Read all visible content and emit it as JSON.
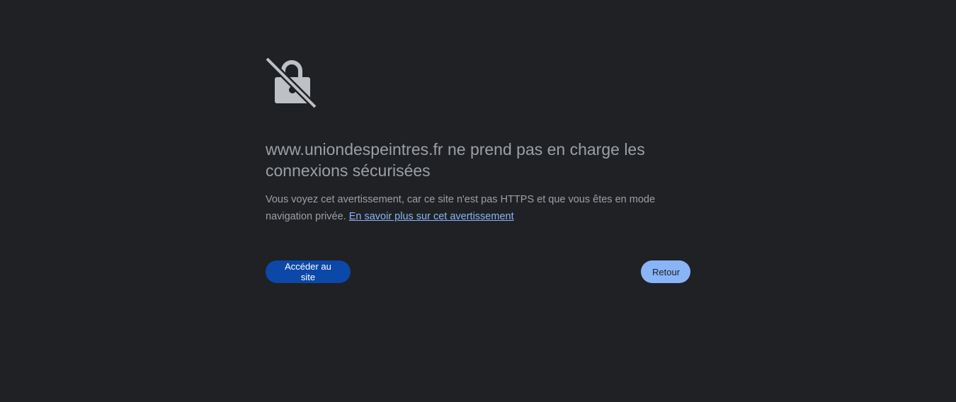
{
  "icon": {
    "name": "lock-crossed-icon",
    "color": "#bdc1c6"
  },
  "heading": "www.uniondespeintres.fr ne prend pas en charge les connexions sécurisées",
  "body": {
    "text": "Vous voyez cet avertissement, car ce site n'est pas HTTPS et que vous êtes en mode navigation privée.",
    "link_label": "En savoir plus sur cet avertissement"
  },
  "buttons": {
    "proceed_label": "Accéder au site",
    "back_label": "Retour"
  },
  "colors": {
    "background": "#202124",
    "text": "#9aa0a6",
    "link": "#8ab4f8",
    "primary_button": "#0b48a8",
    "secondary_button": "#8ab4f8"
  }
}
